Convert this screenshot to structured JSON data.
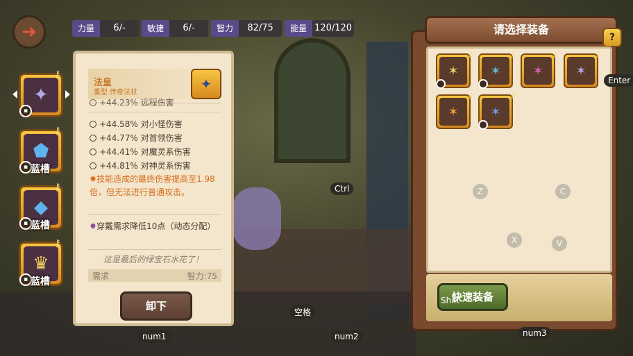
{
  "stats": [
    {
      "label": "力量",
      "value": "6/-"
    },
    {
      "label": "敏捷",
      "value": "6/-"
    },
    {
      "label": "智力",
      "value": "82/75"
    },
    {
      "label": "能量",
      "value": "120/120"
    }
  ],
  "slots": [
    {
      "tag": ""
    },
    {
      "tag": "蓝槽"
    },
    {
      "tag": "蓝槽"
    },
    {
      "tag": "蓝槽"
    }
  ],
  "detail": {
    "name": "法皇",
    "subtitle": "重型 传奇法杖",
    "lines": [
      "+44.23% 远程伤害",
      "+44.58% 对小怪伤害",
      "+44.77% 对首领伤害",
      "+44.41% 对魔灵系伤害",
      "+44.81% 对神灵系伤害"
    ],
    "skill": "技能造成的最终伤害提高至1.98倍，但无法进行普通攻击。",
    "requirement_note": "穿戴需求降低10点（动态分配）",
    "flavor": "这是最后的绿宝石水花了！",
    "req_label": "需求",
    "req_value": "智力:75",
    "unequip": "卸下"
  },
  "right": {
    "title": "请选择装备",
    "help": "?",
    "quick_equip": "快速装备"
  },
  "hints": {
    "enter": "Enter",
    "ctrl": "Ctrl",
    "z": "Z",
    "c": "C",
    "x": "X",
    "v": "V",
    "shift": "Shift",
    "space": "空格",
    "num1": "num1",
    "num2": "num2",
    "num3": "num3"
  }
}
